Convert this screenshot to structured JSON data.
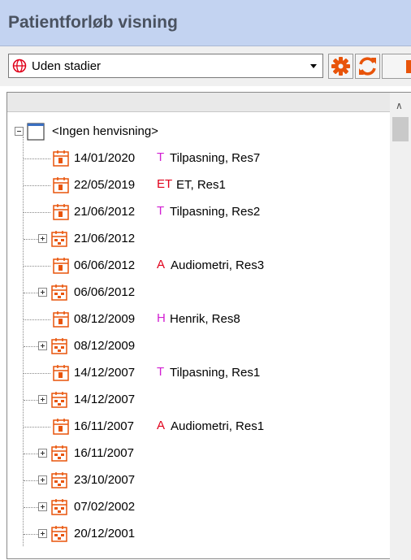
{
  "window": {
    "title": "Patientforløb visning"
  },
  "toolbar": {
    "stage_select": {
      "value": "Uden stadier",
      "icon": "globe-icon"
    },
    "buttons": [
      {
        "icon": "gear-icon",
        "color": "#e8540a"
      },
      {
        "icon": "refresh-icon",
        "color": "#e8540a"
      }
    ]
  },
  "tree": {
    "root": {
      "label": "<Ingen henvisning>"
    },
    "items": [
      {
        "date": "14/01/2020",
        "expandable": false,
        "badge": "T",
        "badge_color": "#d21ed2",
        "desc": "Tilpasning, Res7"
      },
      {
        "date": "22/05/2019",
        "expandable": false,
        "badge": "ET",
        "badge_color": "#e0001a",
        "desc": "ET, Res1"
      },
      {
        "date": "21/06/2012",
        "expandable": false,
        "badge": "T",
        "badge_color": "#d21ed2",
        "desc": "Tilpasning, Res2"
      },
      {
        "date": "21/06/2012",
        "expandable": true,
        "badge": "",
        "badge_color": "",
        "desc": ""
      },
      {
        "date": "06/06/2012",
        "expandable": false,
        "badge": "A",
        "badge_color": "#e0001a",
        "desc": "Audiometri, Res3"
      },
      {
        "date": "06/06/2012",
        "expandable": true,
        "badge": "",
        "badge_color": "",
        "desc": ""
      },
      {
        "date": "08/12/2009",
        "expandable": false,
        "badge": "H",
        "badge_color": "#d21ed2",
        "desc": "Henrik, Res8"
      },
      {
        "date": "08/12/2009",
        "expandable": true,
        "badge": "",
        "badge_color": "",
        "desc": ""
      },
      {
        "date": "14/12/2007",
        "expandable": false,
        "badge": "T",
        "badge_color": "#d21ed2",
        "desc": "Tilpasning, Res1"
      },
      {
        "date": "14/12/2007",
        "expandable": true,
        "badge": "",
        "badge_color": "",
        "desc": ""
      },
      {
        "date": "16/11/2007",
        "expandable": false,
        "badge": "A",
        "badge_color": "#e0001a",
        "desc": "Audiometri, Res1"
      },
      {
        "date": "16/11/2007",
        "expandable": true,
        "badge": "",
        "badge_color": "",
        "desc": ""
      },
      {
        "date": "23/10/2007",
        "expandable": true,
        "badge": "",
        "badge_color": "",
        "desc": ""
      },
      {
        "date": "07/02/2002",
        "expandable": true,
        "badge": "",
        "badge_color": "",
        "desc": ""
      },
      {
        "date": "20/12/2001",
        "expandable": true,
        "badge": "",
        "badge_color": "",
        "desc": ""
      }
    ]
  },
  "colors": {
    "calendar": "#e8540a",
    "title_bg": "#c3d3f1"
  }
}
